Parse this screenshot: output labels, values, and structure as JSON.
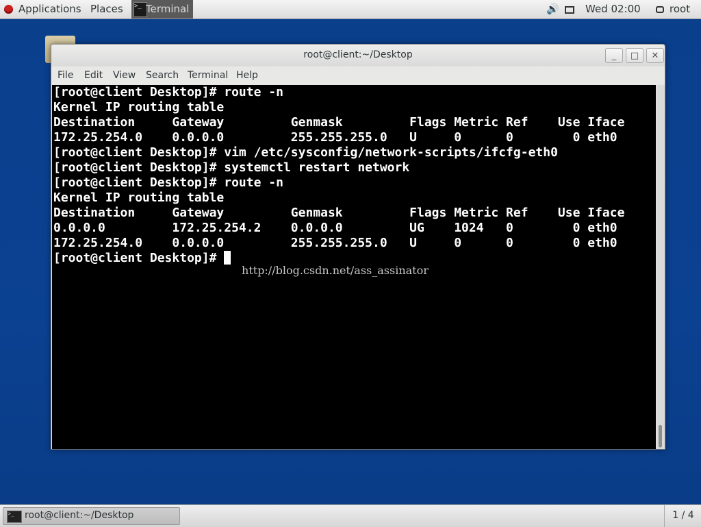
{
  "topbar": {
    "applications": "Applications",
    "places": "Places",
    "active_task": "Terminal",
    "clock": "Wed 02:00",
    "user": "root",
    "icons": [
      "redhat-logo-icon",
      "terminal-icon",
      "sound-icon",
      "network-icon",
      "user-icon"
    ]
  },
  "window": {
    "title": "root@client:~/Desktop",
    "buttons": {
      "minimize": "_",
      "maximize": "□",
      "close": "✕"
    },
    "menu": [
      "File",
      "Edit",
      "View",
      "Search",
      "Terminal",
      "Help"
    ]
  },
  "terminal": {
    "lines": [
      "[root@client Desktop]# route -n",
      "Kernel IP routing table",
      "Destination     Gateway         Genmask         Flags Metric Ref    Use Iface",
      "172.25.254.0    0.0.0.0         255.255.255.0   U     0      0        0 eth0",
      "[root@client Desktop]# vim /etc/sysconfig/network-scripts/ifcfg-eth0",
      "[root@client Desktop]# systemctl restart network",
      "[root@client Desktop]# route -n",
      "Kernel IP routing table",
      "Destination     Gateway         Genmask         Flags Metric Ref    Use Iface",
      "0.0.0.0         172.25.254.2    0.0.0.0         UG    1024   0        0 eth0",
      "172.25.254.0    0.0.0.0         255.255.255.0   U     0      0        0 eth0"
    ],
    "prompt": "[root@client Desktop]# ",
    "watermark": "http://blog.csdn.net/ass_assinator"
  },
  "bottombar": {
    "task": "root@client:~/Desktop",
    "workspace": "1 / 4"
  }
}
